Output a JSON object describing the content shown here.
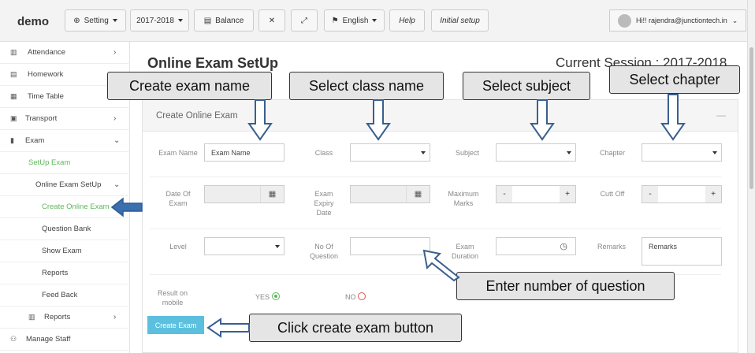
{
  "topbar": {
    "brand": "demo",
    "setting": "Setting",
    "session_select": "2017-2018",
    "balance": "Balance",
    "language": "English",
    "help": "Help",
    "initial_setup": "Initial setup",
    "user": "Hi!! rajendra@junctiontech.in"
  },
  "sidebar": {
    "items": [
      {
        "label": "Attendance",
        "icon": "bar-chart-icon",
        "chev": "›"
      },
      {
        "label": "Homework",
        "icon": "book-icon",
        "chev": ""
      },
      {
        "label": "Time Table",
        "icon": "calendar-icon",
        "chev": ""
      },
      {
        "label": "Transport",
        "icon": "bus-icon",
        "chev": "›"
      },
      {
        "label": "Exam",
        "icon": "file-icon",
        "chev": "⌄"
      },
      {
        "label": "SetUp Exam",
        "chev": ""
      },
      {
        "label": "Online Exam SetUp",
        "chev": "⌄"
      },
      {
        "label": "Create Online Exam",
        "chev": ""
      },
      {
        "label": "Question Bank",
        "chev": ""
      },
      {
        "label": "Show Exam",
        "chev": ""
      },
      {
        "label": "Reports",
        "chev": ""
      },
      {
        "label": "Feed Back",
        "chev": ""
      },
      {
        "label": "Reports",
        "icon": "bar-chart-icon",
        "chev": "›"
      },
      {
        "label": "Manage Staff",
        "icon": "users-icon",
        "chev": ""
      }
    ]
  },
  "page": {
    "title": "Online Exam SetUp",
    "session": "Current Session : 2017-2018"
  },
  "panel": {
    "title": "Create Online Exam",
    "collapse": "—"
  },
  "form": {
    "exam_name_label": "Exam Name",
    "exam_name_placeholder": "Exam Name",
    "class_label": "Class",
    "subject_label": "Subject",
    "chapter_label": "Chapter",
    "date_of_exam_label": "Date Of Exam",
    "expiry_label": "Exam Expiry Date",
    "max_marks_label": "Maximum Marks",
    "cutoff_label": "Cutt Off",
    "minus": "-",
    "plus": "+",
    "level_label": "Level",
    "no_question_label": "No Of Question",
    "duration_label": "Exam Duration",
    "remarks_label": "Remarks",
    "remarks_placeholder": "Remarks",
    "result_label": "Result on mobile",
    "yes": "YES",
    "no": "NO",
    "create_button": "Create Exam"
  },
  "annotations": {
    "exam_name": "Create exam name",
    "class_name": "Select class name",
    "subject": "Select subject",
    "chapter": "Select chapter",
    "no_question": "Enter number of question",
    "create_button": "Click create exam button"
  },
  "colors": {
    "accent_green": "#5cb85c",
    "button_blue": "#5bc0de",
    "arrow_blue": "#3a5f8f"
  }
}
